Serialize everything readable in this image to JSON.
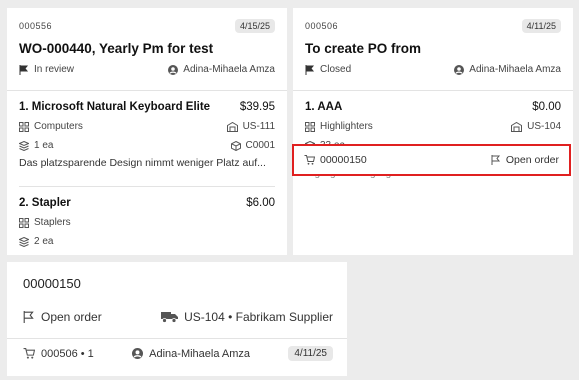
{
  "cards": [
    {
      "id": "000556",
      "date": "4/15/25",
      "title": "WO-000440, Yearly Pm for test",
      "status": "In review",
      "assignee": "Adina-Mihaela Amza",
      "lines": [
        {
          "name": "1. Microsoft Natural Keyboard Elite",
          "price": "$39.95",
          "category": "Computers",
          "warehouse": "US-111",
          "qty": "1 ea",
          "code": "C0001",
          "description": "Das platzsparende Design nimmt weniger Platz auf..."
        },
        {
          "name": "2. Stapler",
          "price": "$6.00",
          "category": "Staplers",
          "qty": "2 ea"
        }
      ]
    },
    {
      "id": "000506",
      "date": "4/11/25",
      "title": "To create PO from",
      "status": "Closed",
      "assignee": "Adina-Mihaela Amza",
      "lines": [
        {
          "name": "1. AAA",
          "price": "$0.00",
          "category": "Highlighters",
          "warehouse": "US-104",
          "qty": "33 ea",
          "description": "Highlighters Highlighters"
        }
      ],
      "po_row": {
        "number": "00000150",
        "status": "Open order"
      }
    }
  ],
  "popup": {
    "title": "00000150",
    "status": "Open order",
    "supplier": "US-104 • Fabrikam Supplier",
    "reference": "000506 • 1",
    "assignee": "Adina-Mihaela Amza",
    "date": "4/11/25"
  },
  "icons": {
    "flag": "flag-icon",
    "person": "person-icon",
    "category": "grid-icon",
    "warehouse": "warehouse-icon",
    "qty": "stack-icon",
    "code": "box-icon",
    "cart": "cart-icon",
    "truck": "truck-icon"
  },
  "colors": {
    "highlight": "#e02020",
    "background": "#ececec",
    "card": "#ffffff"
  }
}
